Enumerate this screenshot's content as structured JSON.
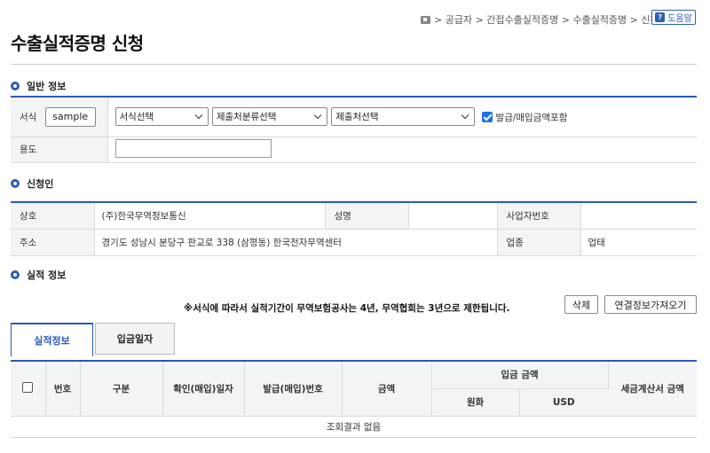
{
  "breadcrumb": "> 공급자 > 간접수출실적증명 > 수출실적증명 > 신청",
  "help_label": "도움말",
  "title": "수출실적증명 신청",
  "general": {
    "section_title": "일반 정보",
    "format_label": "서식",
    "sample_button": "sample",
    "format_select": "서식선택",
    "category_select": "제출처분류선택",
    "submit_to_select": "제출처선택",
    "include_amount_label": "발급/매입금액포함",
    "include_amount_checked": true,
    "purpose_label": "용도",
    "purpose_value": ""
  },
  "applicant": {
    "section_title": "신청인",
    "company_label": "상호",
    "company_value": "(주)한국무역정보통신",
    "name_label": "성명",
    "name_value": "",
    "bizno_label": "사업자번호",
    "bizno_value": "",
    "address_label": "주소",
    "address_value": "경기도 성남시 분당구 판교로 338 (삼평동) 한국전자무역센터",
    "industry_label": "업종",
    "industry_value": "업태"
  },
  "performance": {
    "section_title": "실적 정보",
    "notice": "※서식에 따라서 실적기간이 무역보험공사는 4년, 무역협회는 3년으로 제한됩니다.",
    "delete_button": "삭제",
    "fetch_button": "연결정보가져오기",
    "tabs": [
      "실적정보",
      "입금일자"
    ],
    "columns": {
      "no": "번호",
      "type": "구분",
      "confirm_date": "확인(매입)일자",
      "issue_no": "발급(매입)번호",
      "amount": "금액",
      "deposit_amount": "입금 금액",
      "krw": "원화",
      "usd": "USD",
      "tax_invoice_amount": "세금계산서 금액"
    },
    "empty_message": "조회결과 없음"
  }
}
